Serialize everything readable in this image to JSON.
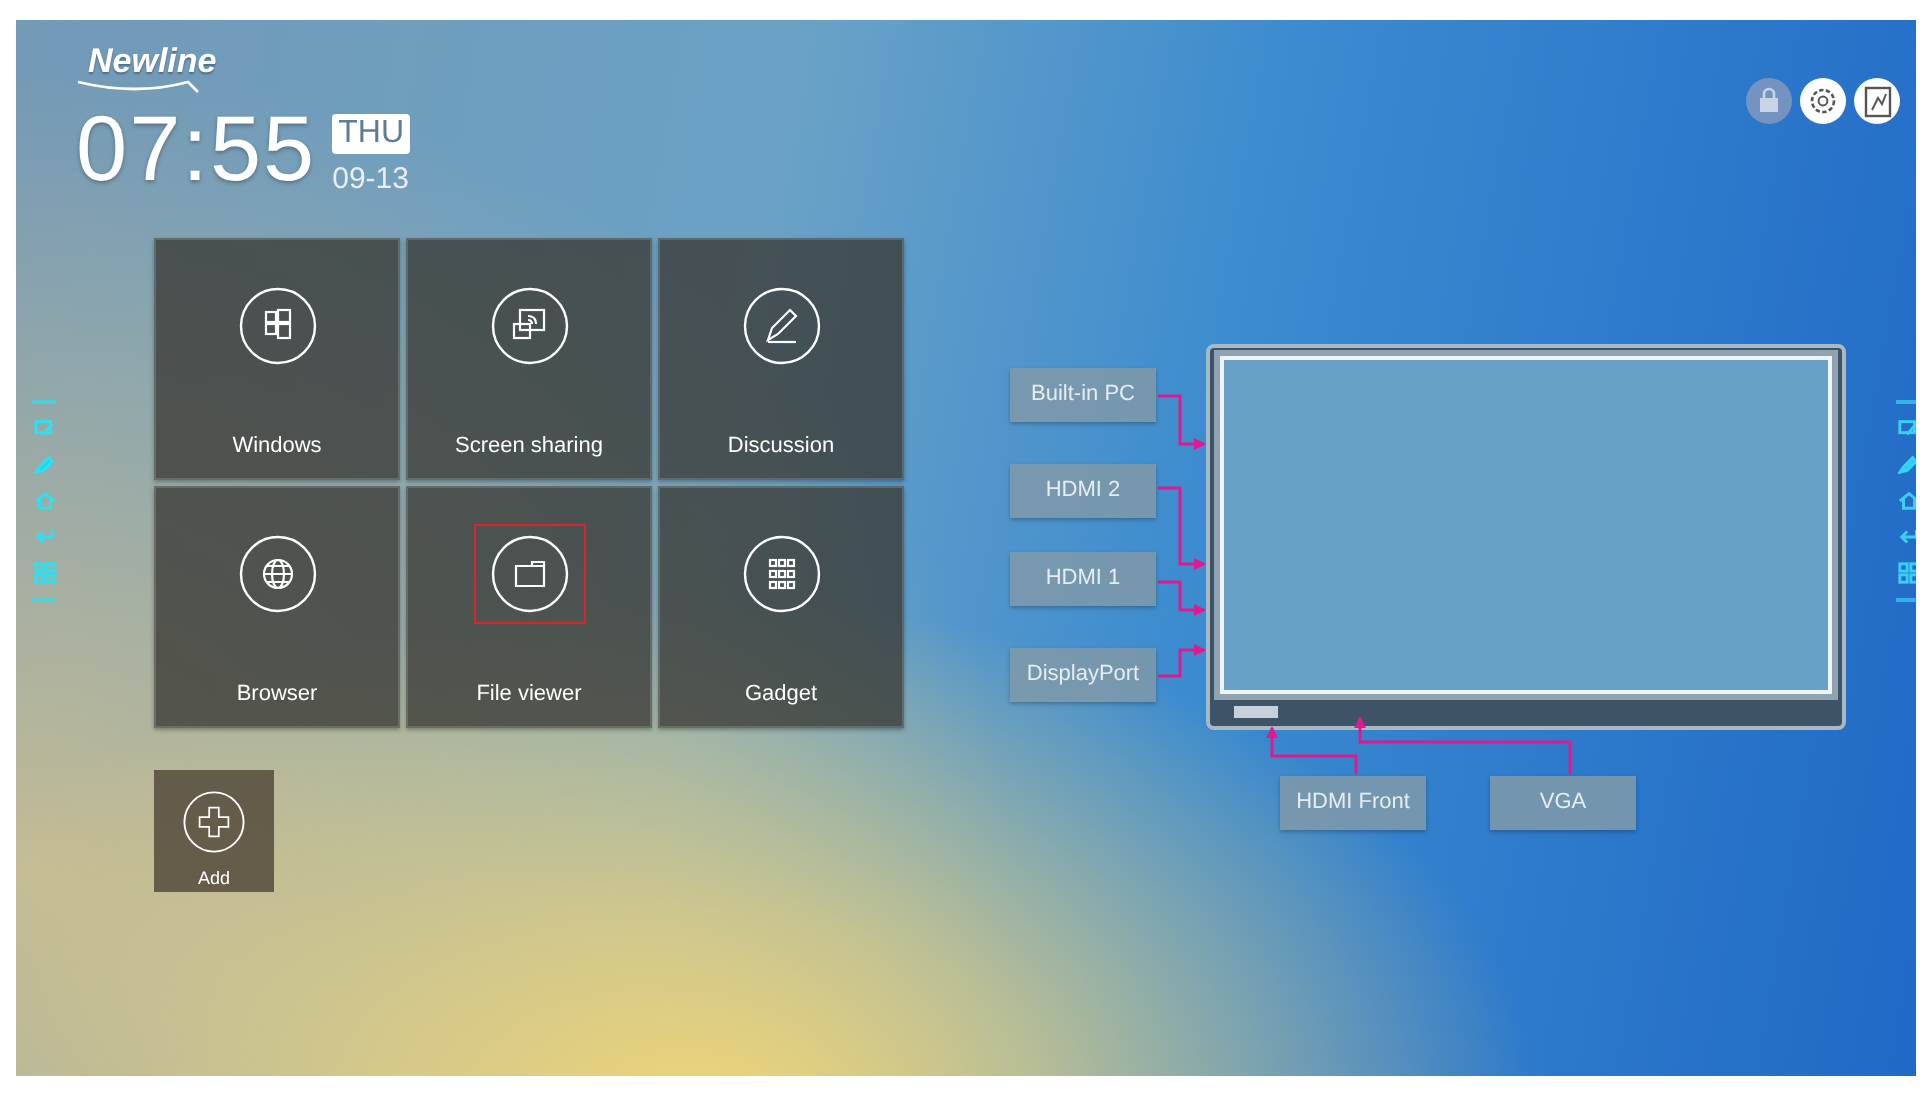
{
  "brand": {
    "logo": "Newline"
  },
  "clock": {
    "time": "07:55",
    "weekday": "THU",
    "date": "09-13"
  },
  "top_actions": [
    {
      "kind": "lock",
      "disabled": true
    },
    {
      "kind": "settings",
      "disabled": false
    },
    {
      "kind": "whiteboard",
      "disabled": false
    }
  ],
  "tiles": [
    {
      "label": "Windows",
      "kind": "windows",
      "selected": false
    },
    {
      "label": "Screen sharing",
      "kind": "share",
      "selected": false
    },
    {
      "label": "Discussion",
      "kind": "pen",
      "selected": false
    },
    {
      "label": "Browser",
      "kind": "globe",
      "selected": false
    },
    {
      "label": "File viewer",
      "kind": "folder",
      "selected": true
    },
    {
      "label": "Gadget",
      "kind": "apps",
      "selected": false
    }
  ],
  "add_tile": {
    "label": "Add"
  },
  "inputs": [
    {
      "label": "Built-in PC",
      "kind": "side"
    },
    {
      "label": "HDMI 2",
      "kind": "side"
    },
    {
      "label": "HDMI 1",
      "kind": "side"
    },
    {
      "label": "DisplayPort",
      "kind": "side"
    },
    {
      "label": "HDMI Front",
      "kind": "bottom"
    },
    {
      "label": "VGA",
      "kind": "bottom"
    }
  ]
}
